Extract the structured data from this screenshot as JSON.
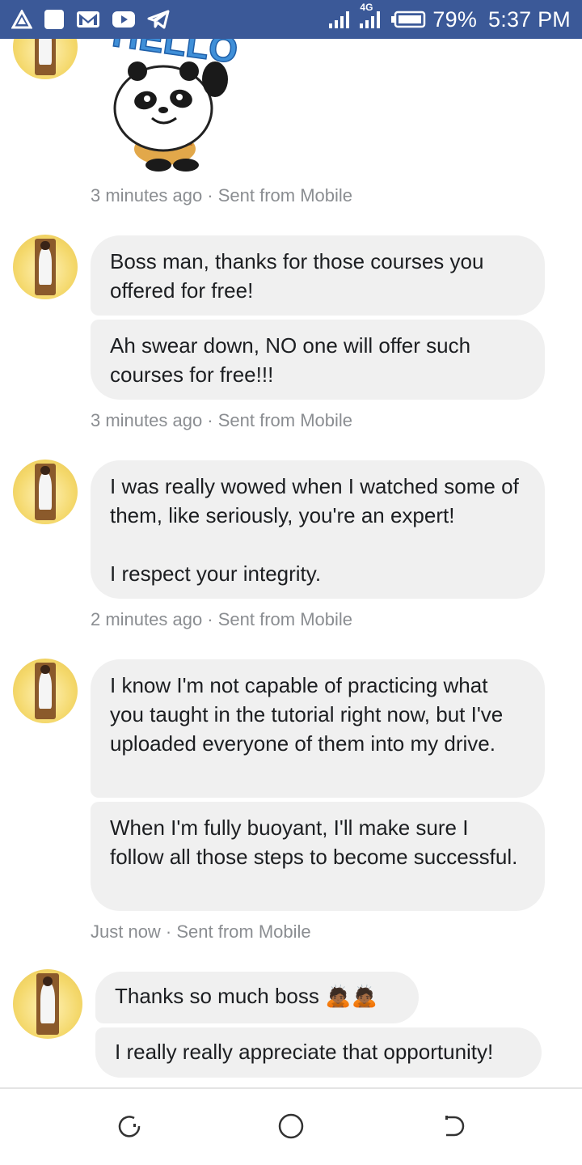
{
  "status_bar": {
    "battery_percent": "79%",
    "time": "5:37 PM",
    "network": "4G",
    "icons": [
      "triangle-alert-icon",
      "square-app-icon",
      "gmail-icon",
      "youtube-icon",
      "telegram-icon",
      "signal-icon",
      "signal-4g-icon",
      "battery-icon"
    ]
  },
  "sticker": {
    "text": "HELLO",
    "name": "hello-panda-sticker"
  },
  "messages": [
    {
      "bubbles": [],
      "meta": "3 minutes ago · Sent from Mobile"
    },
    {
      "bubbles": [
        "Boss man, thanks for those courses you offered for free!",
        "Ah swear down, NO one will offer such courses for free!!!"
      ],
      "meta": "3 minutes ago · Sent from Mobile"
    },
    {
      "bubbles": [
        "I was really wowed when I watched some of them, like seriously, you're an expert!\n\n I respect your integrity."
      ],
      "meta": "2 minutes ago · Sent from Mobile"
    },
    {
      "bubbles": [
        "I know I'm not capable of practicing what you taught in the tutorial right now, but I've uploaded everyone of them into my drive.",
        "When I'm fully buoyant, I'll make sure I follow all those steps to become successful."
      ],
      "meta": "Just now · Sent from Mobile"
    },
    {
      "bubbles": [
        "Thanks so much boss 🙇🏾🙇🏾",
        "I really really appreciate that opportunity!"
      ],
      "meta": ""
    }
  ],
  "nav": {
    "icons": [
      "recent-apps-icon",
      "home-icon",
      "back-icon"
    ]
  }
}
